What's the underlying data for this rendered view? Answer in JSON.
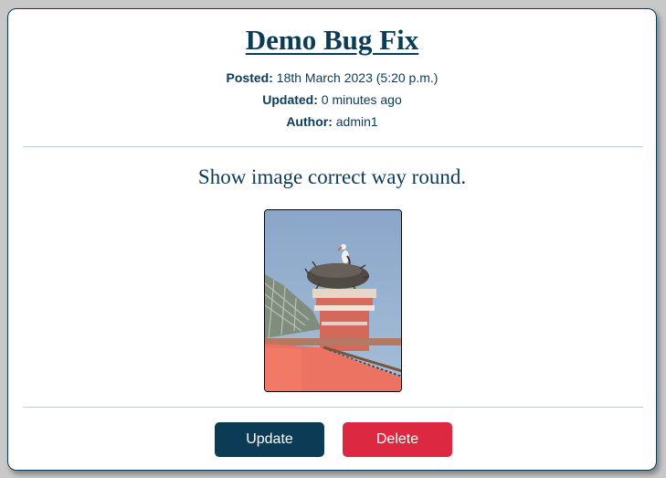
{
  "post": {
    "title": "Demo Bug Fix",
    "posted_label": "Posted:",
    "posted_value": "18th March 2023 (5:20 p.m.)",
    "updated_label": "Updated:",
    "updated_value": "0 minutes ago",
    "author_label": "Author:",
    "author_value": "admin1",
    "content": "Show image correct way round."
  },
  "actions": {
    "update_label": "Update",
    "delete_label": "Delete"
  },
  "colors": {
    "primary": "#0b3b55",
    "danger": "#dc2841",
    "background": "#c8c8c8",
    "card": "#ffffff"
  }
}
